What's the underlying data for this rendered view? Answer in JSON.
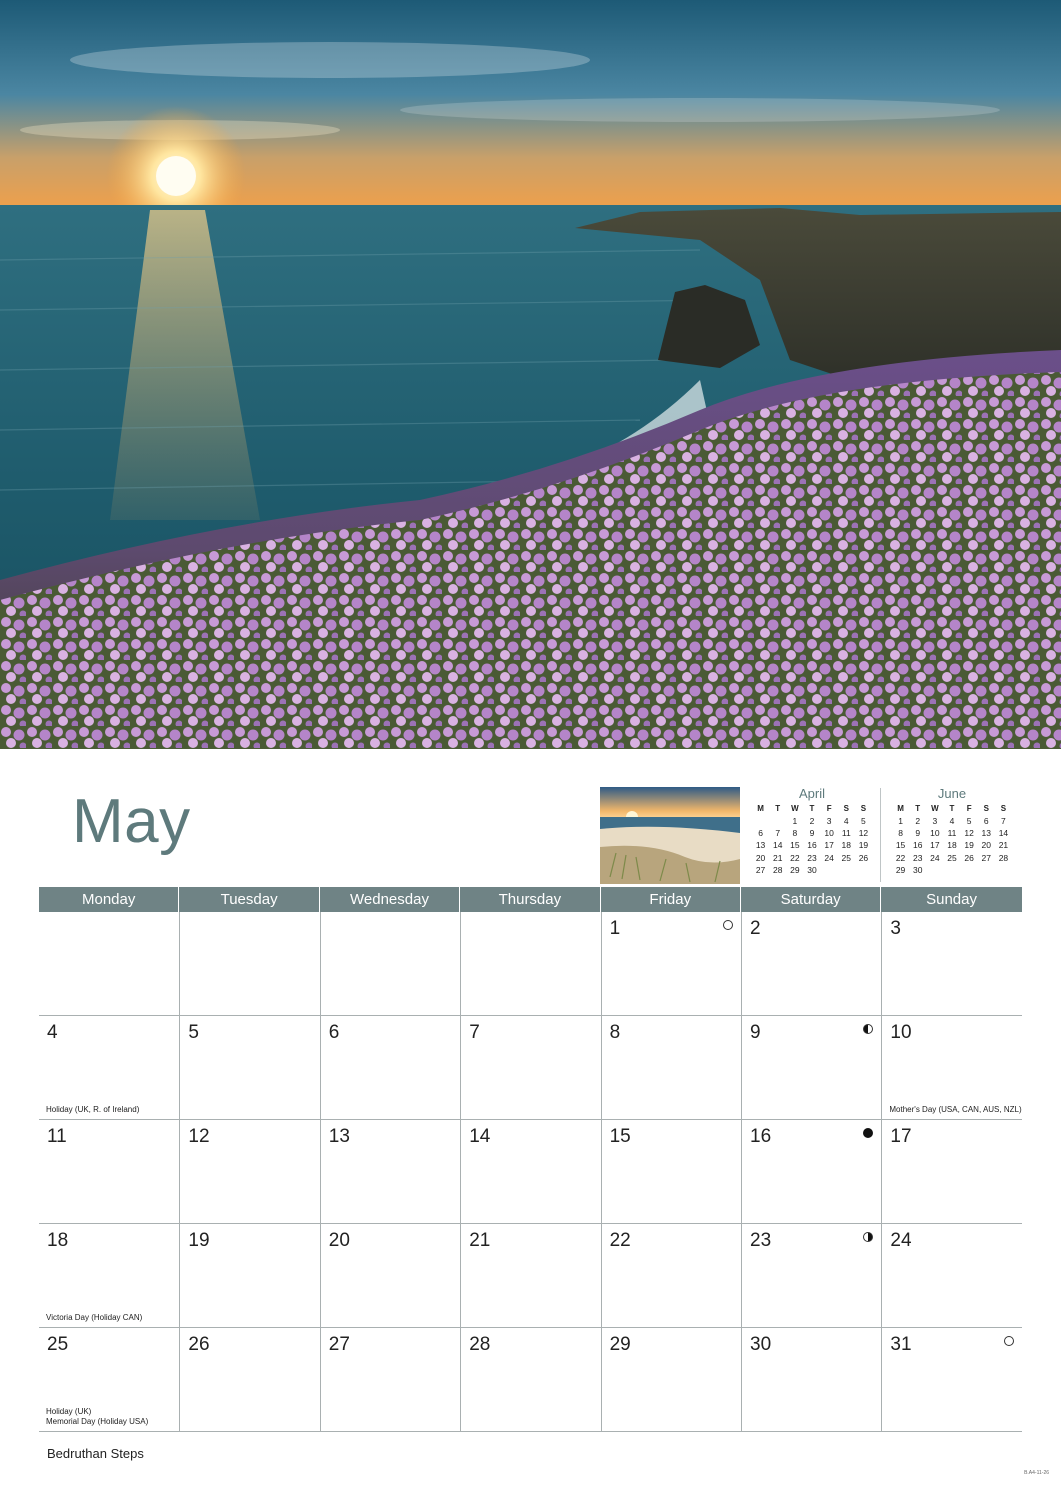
{
  "hero": {
    "subject": "hero-photo-coastal-sunset"
  },
  "month": {
    "title": "May"
  },
  "thumbnail": {
    "subject": "thumbnail-photo-beach-dunes"
  },
  "mini_calendars": [
    {
      "title": "April",
      "headers": [
        "M",
        "T",
        "W",
        "T",
        "F",
        "S",
        "S"
      ],
      "rows": [
        [
          "",
          "",
          "1",
          "2",
          "3",
          "4",
          "5"
        ],
        [
          "6",
          "7",
          "8",
          "9",
          "10",
          "11",
          "12"
        ],
        [
          "13",
          "14",
          "15",
          "16",
          "17",
          "18",
          "19"
        ],
        [
          "20",
          "21",
          "22",
          "23",
          "24",
          "25",
          "26"
        ],
        [
          "27",
          "28",
          "29",
          "30",
          "",
          "",
          ""
        ]
      ]
    },
    {
      "title": "June",
      "headers": [
        "M",
        "T",
        "W",
        "T",
        "F",
        "S",
        "S"
      ],
      "rows": [
        [
          "1",
          "2",
          "3",
          "4",
          "5",
          "6",
          "7"
        ],
        [
          "8",
          "9",
          "10",
          "11",
          "12",
          "13",
          "14"
        ],
        [
          "15",
          "16",
          "17",
          "18",
          "19",
          "20",
          "21"
        ],
        [
          "22",
          "23",
          "24",
          "25",
          "26",
          "27",
          "28"
        ],
        [
          "29",
          "30",
          "",
          "",
          "",
          "",
          ""
        ]
      ]
    }
  ],
  "weekdays": [
    "Monday",
    "Tuesday",
    "Wednesday",
    "Thursday",
    "Friday",
    "Saturday",
    "Sunday"
  ],
  "weeks": [
    [
      {
        "day": ""
      },
      {
        "day": ""
      },
      {
        "day": ""
      },
      {
        "day": ""
      },
      {
        "day": "1",
        "moon": "full"
      },
      {
        "day": "2"
      },
      {
        "day": "3"
      }
    ],
    [
      {
        "day": "4",
        "note": "Holiday (UK, R. of Ireland)"
      },
      {
        "day": "5"
      },
      {
        "day": "6"
      },
      {
        "day": "7"
      },
      {
        "day": "8"
      },
      {
        "day": "9",
        "moon": "last-quarter"
      },
      {
        "day": "10",
        "note": "Mother's Day (USA, CAN, AUS, NZL)"
      }
    ],
    [
      {
        "day": "11"
      },
      {
        "day": "12"
      },
      {
        "day": "13"
      },
      {
        "day": "14"
      },
      {
        "day": "15"
      },
      {
        "day": "16",
        "moon": "new"
      },
      {
        "day": "17"
      }
    ],
    [
      {
        "day": "18",
        "note": "Victoria Day (Holiday CAN)"
      },
      {
        "day": "19"
      },
      {
        "day": "20"
      },
      {
        "day": "21"
      },
      {
        "day": "22"
      },
      {
        "day": "23",
        "moon": "first-quarter"
      },
      {
        "day": "24"
      }
    ],
    [
      {
        "day": "25",
        "note": "Holiday (UK)\nMemorial Day (Holiday USA)"
      },
      {
        "day": "26"
      },
      {
        "day": "27"
      },
      {
        "day": "28"
      },
      {
        "day": "29"
      },
      {
        "day": "30"
      },
      {
        "day": "31",
        "moon": "full"
      }
    ]
  ],
  "caption": "Bedruthan Steps",
  "code": "B.A4-11-26",
  "colors": {
    "accent": "#5e7a7c",
    "header_bg": "#6f8385",
    "grid_line": "#a9b0b1"
  }
}
